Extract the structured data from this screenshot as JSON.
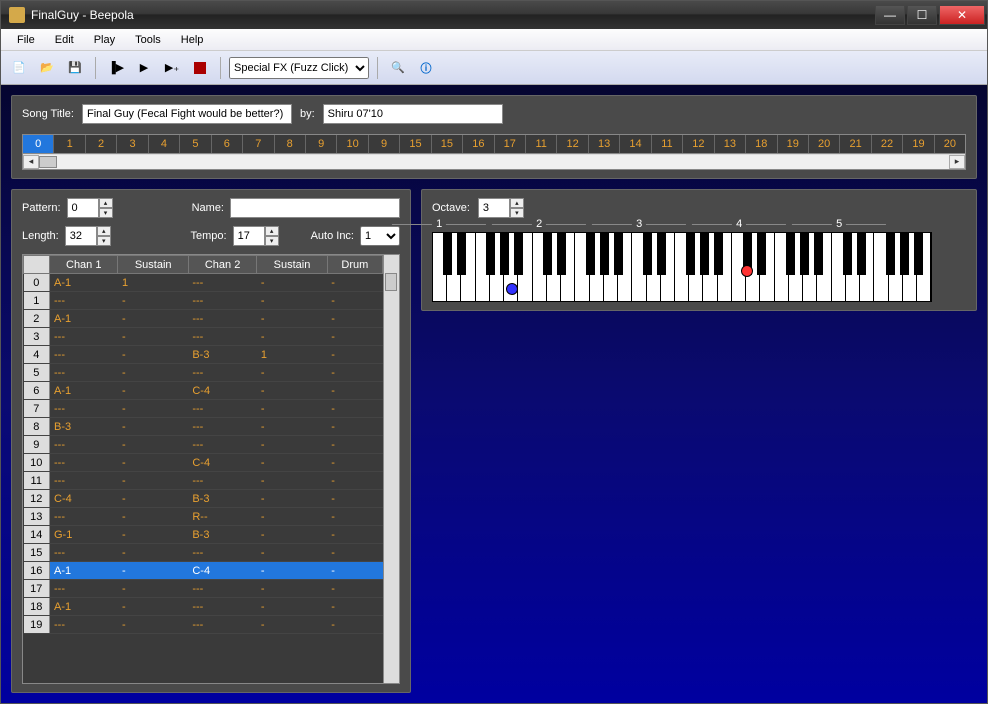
{
  "window": {
    "title": "FinalGuy - Beepola"
  },
  "menu": [
    "File",
    "Edit",
    "Play",
    "Tools",
    "Help"
  ],
  "toolbar": {
    "engine_selected": "Special FX (Fuzz Click)"
  },
  "song": {
    "title_label": "Song Title:",
    "title_value": "Final Guy (Fecal Fight would be better?)",
    "by_label": "by:",
    "by_value": "Shiru 07'10"
  },
  "sequence": [
    {
      "n": "0",
      "sel": true
    },
    {
      "n": "1"
    },
    {
      "n": "2"
    },
    {
      "n": "3"
    },
    {
      "n": "4"
    },
    {
      "n": "5"
    },
    {
      "n": "6"
    },
    {
      "n": "7"
    },
    {
      "n": "8"
    },
    {
      "n": "9"
    },
    {
      "n": "10"
    },
    {
      "n": "9"
    },
    {
      "n": "15"
    },
    {
      "n": "15"
    },
    {
      "n": "16"
    },
    {
      "n": "17"
    },
    {
      "n": "11"
    },
    {
      "n": "12"
    },
    {
      "n": "13"
    },
    {
      "n": "14"
    },
    {
      "n": "11"
    },
    {
      "n": "12"
    },
    {
      "n": "13"
    },
    {
      "n": "18"
    },
    {
      "n": "19"
    },
    {
      "n": "20"
    },
    {
      "n": "21"
    },
    {
      "n": "22"
    },
    {
      "n": "19"
    },
    {
      "n": "20"
    }
  ],
  "pattern_ctrl": {
    "pattern_label": "Pattern:",
    "pattern_value": "0",
    "name_label": "Name:",
    "name_value": "",
    "length_label": "Length:",
    "length_value": "32",
    "tempo_label": "Tempo:",
    "tempo_value": "17",
    "autoinc_label": "Auto Inc:",
    "autoinc_value": "1"
  },
  "tracker": {
    "headers": [
      "",
      "Chan 1",
      "Sustain",
      "Chan 2",
      "Sustain",
      "Drum"
    ],
    "rows": [
      {
        "i": 0,
        "c1": "A-1",
        "s1": "1",
        "c2": "---",
        "s2": "-",
        "d": "-"
      },
      {
        "i": 1,
        "c1": "---",
        "s1": "-",
        "c2": "---",
        "s2": "-",
        "d": "-"
      },
      {
        "i": 2,
        "c1": "A-1",
        "s1": "-",
        "c2": "---",
        "s2": "-",
        "d": "-"
      },
      {
        "i": 3,
        "c1": "---",
        "s1": "-",
        "c2": "---",
        "s2": "-",
        "d": "-"
      },
      {
        "i": 4,
        "c1": "---",
        "s1": "-",
        "c2": "B-3",
        "s2": "1",
        "d": "-"
      },
      {
        "i": 5,
        "c1": "---",
        "s1": "-",
        "c2": "---",
        "s2": "-",
        "d": "-"
      },
      {
        "i": 6,
        "c1": "A-1",
        "s1": "-",
        "c2": "C-4",
        "s2": "-",
        "d": "-"
      },
      {
        "i": 7,
        "c1": "---",
        "s1": "-",
        "c2": "---",
        "s2": "-",
        "d": "-"
      },
      {
        "i": 8,
        "c1": "B-3",
        "s1": "-",
        "c2": "---",
        "s2": "-",
        "d": "-"
      },
      {
        "i": 9,
        "c1": "---",
        "s1": "-",
        "c2": "---",
        "s2": "-",
        "d": "-"
      },
      {
        "i": 10,
        "c1": "---",
        "s1": "-",
        "c2": "C-4",
        "s2": "-",
        "d": "-"
      },
      {
        "i": 11,
        "c1": "---",
        "s1": "-",
        "c2": "---",
        "s2": "-",
        "d": "-"
      },
      {
        "i": 12,
        "c1": "C-4",
        "s1": "-",
        "c2": "B-3",
        "s2": "-",
        "d": "-"
      },
      {
        "i": 13,
        "c1": "---",
        "s1": "-",
        "c2": "R--",
        "s2": "-",
        "d": "-"
      },
      {
        "i": 14,
        "c1": "G-1",
        "s1": "-",
        "c2": "B-3",
        "s2": "-",
        "d": "-"
      },
      {
        "i": 15,
        "c1": "---",
        "s1": "-",
        "c2": "---",
        "s2": "-",
        "d": "-"
      },
      {
        "i": 16,
        "c1": "A-1",
        "s1": "-",
        "c2": "C-4",
        "s2": "-",
        "d": "-",
        "sel": true
      },
      {
        "i": 17,
        "c1": "---",
        "s1": "-",
        "c2": "---",
        "s2": "-",
        "d": "-"
      },
      {
        "i": 18,
        "c1": "A-1",
        "s1": "-",
        "c2": "---",
        "s2": "-",
        "d": "-"
      },
      {
        "i": 19,
        "c1": "---",
        "s1": "-",
        "c2": "---",
        "s2": "-",
        "d": "-"
      }
    ]
  },
  "keyboard": {
    "octave_label": "Octave:",
    "octave_value": "3",
    "octave_markers": [
      "1",
      "2",
      "3",
      "4",
      "5"
    ]
  }
}
